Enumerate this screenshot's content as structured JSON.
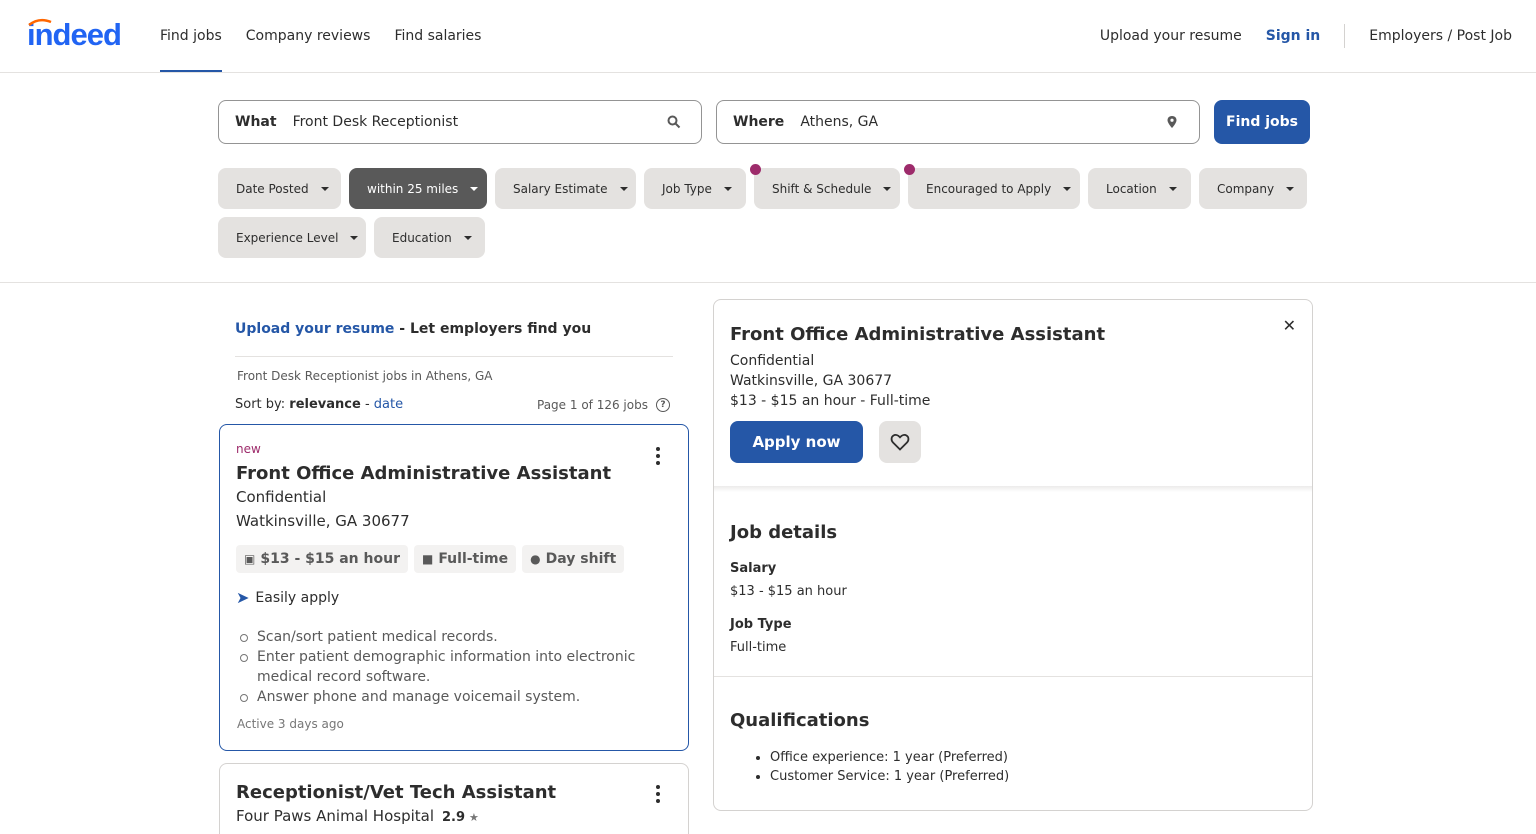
{
  "brand": {
    "logo_text": "indeed",
    "logo_color": "#2164f3",
    "accent": "#2557a7"
  },
  "nav": {
    "find_jobs": "Find jobs",
    "company_reviews": "Company reviews",
    "find_salaries": "Find salaries"
  },
  "right_nav": {
    "upload": "Upload your resume",
    "signin": "Sign in",
    "employers": "Employers / Post Job"
  },
  "search": {
    "what_label": "What",
    "what_value": "Front Desk Receptionist",
    "where_label": "Where",
    "where_value": "Athens, GA",
    "find_button": "Find jobs"
  },
  "filters": [
    "Date Posted",
    "within 25 miles",
    "Salary Estimate",
    "Job Type",
    "Shift & Schedule",
    "Encouraged to Apply",
    "Location",
    "Company",
    "Experience Level",
    "Education"
  ],
  "left": {
    "upload_link": "Upload your resume",
    "upload_rest": " - Let employers find you",
    "jobs_in": "Front Desk Receptionist jobs in Athens, GA",
    "sort_prefix": "Sort by: ",
    "sort_relevance": "relevance",
    "sort_dash": " - ",
    "sort_date": "date",
    "page_count": "Page 1 of 126 jobs"
  },
  "jobs": [
    {
      "badge": "new",
      "title": "Front Office Administrative Assistant",
      "company": "Confidential",
      "location": "Watkinsville, GA 30677",
      "tags": [
        "$13 - $15 an hour",
        "Full-time",
        "Day shift"
      ],
      "easily_apply": "Easily apply",
      "bullets": [
        "Scan/sort patient medical records.",
        "Enter patient demographic information into electronic medical record software.",
        "Answer phone and manage voicemail system."
      ],
      "active": "Active 3 days ago"
    },
    {
      "title": "Receptionist/Vet Tech Assistant",
      "company": "Four Paws Animal Hospital",
      "rating": "2.9"
    }
  ],
  "detail": {
    "title": "Front Office Administrative Assistant",
    "company": "Confidential",
    "location": "Watkinsville, GA 30677",
    "pay_type": "$13 - $15 an hour  - Full-time",
    "apply": "Apply now",
    "job_details_heading": "Job details",
    "salary_label": "Salary",
    "salary_value": "$13 - $15 an hour",
    "jobtype_label": "Job Type",
    "jobtype_value": "Full-time",
    "qualifications_heading": "Qualifications",
    "qualifications": [
      "Office experience: 1 year (Preferred)",
      "Customer Service: 1 year (Preferred)"
    ]
  }
}
